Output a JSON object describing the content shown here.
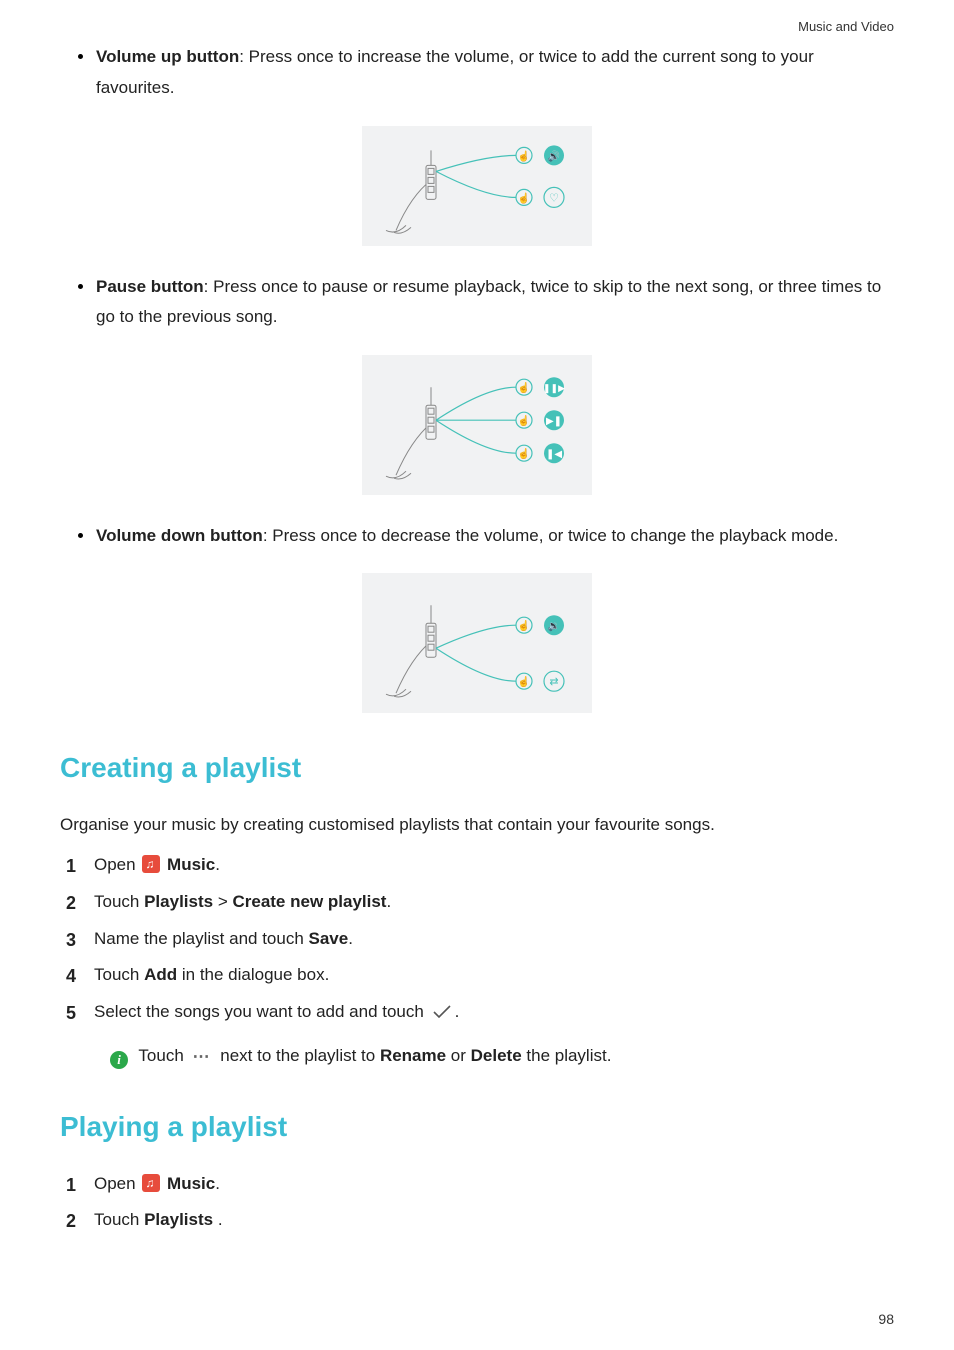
{
  "header": {
    "section_title": "Music and Video"
  },
  "bullets": {
    "vol_up": {
      "label": "Volume up button",
      "text": ": Press once to increase the volume, or twice to add the current song to your favourites."
    },
    "pause": {
      "label": "Pause button",
      "text": ": Press once to pause or resume playback, twice to skip to the next song, or three times to go to the previous song."
    },
    "vol_down": {
      "label": "Volume down button",
      "text": ": Press once to decrease the volume, or twice to change the playback mode."
    }
  },
  "creating": {
    "heading": "Creating a playlist",
    "intro": "Organise your music by creating customised playlists that contain your favourite songs.",
    "steps": {
      "s1_a": "Open ",
      "s1_b": " Music",
      "s1_c": ".",
      "s2_a": "Touch ",
      "s2_b": "Playlists",
      "s2_c": " > ",
      "s2_d": "Create new playlist",
      "s2_e": ".",
      "s3_a": "Name the playlist and touch ",
      "s3_b": "Save",
      "s3_c": ".",
      "s4_a": "Touch ",
      "s4_b": "Add",
      "s4_c": " in the dialogue box.",
      "s5_a": "Select the songs you want to add and touch ",
      "s5_b": "."
    },
    "info": {
      "a": "Touch ",
      "b": " next to the playlist to ",
      "c": "Rename",
      "d": " or ",
      "e": "Delete",
      "f": " the playlist."
    }
  },
  "playing": {
    "heading": "Playing a playlist",
    "steps": {
      "s1_a": "Open ",
      "s1_b": " Music",
      "s1_c": ".",
      "s2_a": "Touch ",
      "s2_b": "Playlists",
      "s2_c": " ."
    }
  },
  "page_number": "98",
  "icons": {
    "music_app": "music-app-icon",
    "checkmark": "checkmark-icon",
    "info": "info-icon",
    "more_dots": "more-options-icon"
  }
}
